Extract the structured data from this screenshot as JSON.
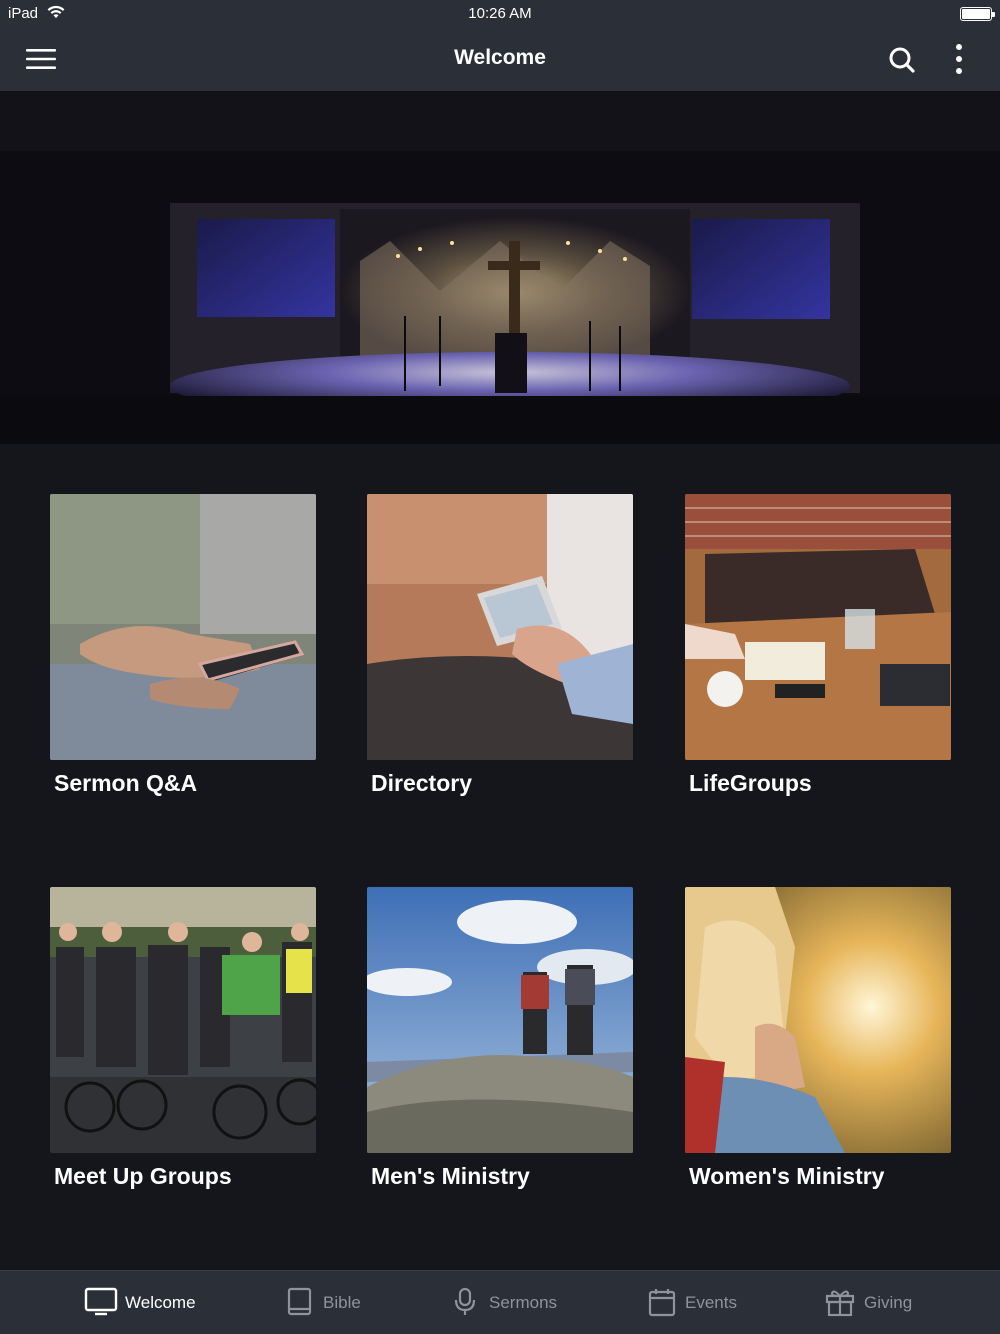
{
  "status_bar": {
    "device": "iPad",
    "time": "10:26 AM"
  },
  "nav": {
    "title": "Welcome",
    "icons": [
      "hamburger-menu-icon",
      "search-icon",
      "more-vertical-icon"
    ]
  },
  "hero": {
    "image": "church-sanctuary-stage-with-cross"
  },
  "tiles": [
    {
      "label": "Sermon Q&A",
      "image": "hands-holding-smartphone"
    },
    {
      "label": "Directory",
      "image": "person-texting-on-phone-with-bag"
    },
    {
      "label": "LifeGroups",
      "image": "coffee-table-with-notebook-and-bag"
    },
    {
      "label": "Meet Up Groups",
      "image": "group-of-cyclists-with-bikes"
    },
    {
      "label": "Men's Ministry",
      "image": "two-hikers-on-mountain-top"
    },
    {
      "label": "Women's Ministry",
      "image": "woman-in-sunset-light"
    }
  ],
  "tab_bar": {
    "active": "Welcome",
    "tabs": [
      {
        "label": "Welcome",
        "icon": "monitor-icon"
      },
      {
        "label": "Bible",
        "icon": "book-icon"
      },
      {
        "label": "Sermons",
        "icon": "microphone-icon"
      },
      {
        "label": "Events",
        "icon": "calendar-icon"
      },
      {
        "label": "Giving",
        "icon": "gift-icon"
      }
    ]
  },
  "colors": {
    "background": "#15161b",
    "bars": "#2b2f37",
    "active_tab": "#ffffff",
    "inactive_tab": "#8e939c"
  }
}
